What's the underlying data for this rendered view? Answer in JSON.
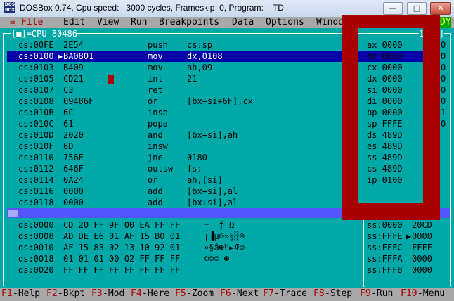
{
  "window": {
    "title": "DOSBox 0.74, Cpu speed:   3000 cycles, Frameskip  0, Program:    TD",
    "minimize": "—",
    "maximize": "□",
    "close": "✕"
  },
  "menu": {
    "system": "≡",
    "items": [
      "File",
      "Edit",
      "View",
      "Run",
      "Breakpoints",
      "Data",
      "Options",
      "Windo"
    ],
    "status": "DY"
  },
  "cpu": {
    "title": "[■]=CPU 80486",
    "right_title": "1=[↑]",
    "rows": [
      {
        "addr": "cs:00FE",
        "bytes": "2E54",
        "mn": "push",
        "ops": "cs:sp"
      },
      {
        "addr": "cs:0100",
        "bytes": "BA0801",
        "mn": "mov",
        "ops": "dx,0108",
        "current": true
      },
      {
        "addr": "cs:0103",
        "bytes": "B409",
        "mn": "mov",
        "ops": "ah,09"
      },
      {
        "addr": "cs:0105",
        "bytes": "CD21",
        "mn": "int",
        "ops": "21"
      },
      {
        "addr": "cs:0107",
        "bytes": "C3",
        "mn": "ret",
        "ops": ""
      },
      {
        "addr": "cs:0108",
        "bytes": "09486F",
        "mn": "or",
        "ops": "[bx+si+6F],cx"
      },
      {
        "addr": "cs:010B",
        "bytes": "6C",
        "mn": "insb",
        "ops": ""
      },
      {
        "addr": "cs:010C",
        "bytes": "61",
        "mn": "popa",
        "ops": ""
      },
      {
        "addr": "cs:010D",
        "bytes": "2020",
        "mn": "and",
        "ops": "[bx+si],ah"
      },
      {
        "addr": "cs:010F",
        "bytes": "6D",
        "mn": "insw",
        "ops": ""
      },
      {
        "addr": "cs:0110",
        "bytes": "756E",
        "mn": "jne",
        "ops": "0180"
      },
      {
        "addr": "cs:0112",
        "bytes": "646F",
        "mn": "outsw",
        "ops": "fs:"
      },
      {
        "addr": "cs:0114",
        "bytes": "0A24",
        "mn": "or",
        "ops": "ah,[si]"
      },
      {
        "addr": "cs:0116",
        "bytes": "0000",
        "mn": "add",
        "ops": "[bx+si],al"
      },
      {
        "addr": "cs:0118",
        "bytes": "0000",
        "mn": "add",
        "ops": "[bx+si],al"
      }
    ],
    "current_marker": "▶"
  },
  "registers": [
    {
      "name": "ax",
      "value": "0000"
    },
    {
      "name": "bx",
      "value": "0000"
    },
    {
      "name": "cx",
      "value": "0000"
    },
    {
      "name": "dx",
      "value": "0000"
    },
    {
      "name": "si",
      "value": "0000"
    },
    {
      "name": "di",
      "value": "0000"
    },
    {
      "name": "bp",
      "value": "0000"
    },
    {
      "name": "sp",
      "value": "FFFE"
    },
    {
      "name": "ds",
      "value": "489D"
    },
    {
      "name": "es",
      "value": "489D"
    },
    {
      "name": "ss",
      "value": "489D"
    },
    {
      "name": "cs",
      "value": "489D"
    },
    {
      "name": "ip",
      "value": "0100"
    }
  ],
  "flags": [
    "0",
    "0",
    "0",
    "0",
    "0",
    "0",
    "1",
    "0"
  ],
  "dump": [
    {
      "addr": "ds:0000",
      "bytes": "CD 20 FF 9F 00 EA FF FF",
      "ascii": "=  ƒ Ω"
    },
    {
      "addr": "ds:0008",
      "bytes": "AD DE E6 01 AF 15 B0 01",
      "ascii": "¡▐µ☺»§░☺"
    },
    {
      "addr": "ds:0010",
      "bytes": "AF 15 83 02 13 10 92 01",
      "ascii": "»§â☻‼►Æ☺"
    },
    {
      "addr": "ds:0018",
      "bytes": "01 01 01 00 02 FF FF FF",
      "ascii": "☺☺☺ ☻"
    },
    {
      "addr": "ds:0020",
      "bytes": "FF FF FF FF FF FF FF FF",
      "ascii": ""
    }
  ],
  "stack": [
    {
      "addr": "ss:0000",
      "value": "20CD"
    },
    {
      "addr": "ss:FFFE",
      "value": "0000",
      "marker": "▶"
    },
    {
      "addr": "ss:FFFC",
      "value": "FFFF"
    },
    {
      "addr": "ss:FFFA",
      "value": "0000"
    },
    {
      "addr": "ss:FFF8",
      "value": "0000"
    }
  ],
  "fkeys": [
    {
      "key": "F1",
      "label": "Help"
    },
    {
      "key": "F2",
      "label": "Bkpt"
    },
    {
      "key": "F3",
      "label": "Mod"
    },
    {
      "key": "F4",
      "label": "Here"
    },
    {
      "key": "F5",
      "label": "Zoom"
    },
    {
      "key": "F6",
      "label": "Next"
    },
    {
      "key": "F7",
      "label": "Trace"
    },
    {
      "key": "F8",
      "label": "Step"
    },
    {
      "key": "F9",
      "label": "Run"
    },
    {
      "key": "F10",
      "label": "Menu"
    }
  ],
  "colors": {
    "screen": "#00a8a8",
    "menubar": "#a8a8a8",
    "hotkey": "#a80000",
    "highlight": "#0000a8",
    "overlay": "#a80000",
    "scrollbar": "#5454fc"
  }
}
